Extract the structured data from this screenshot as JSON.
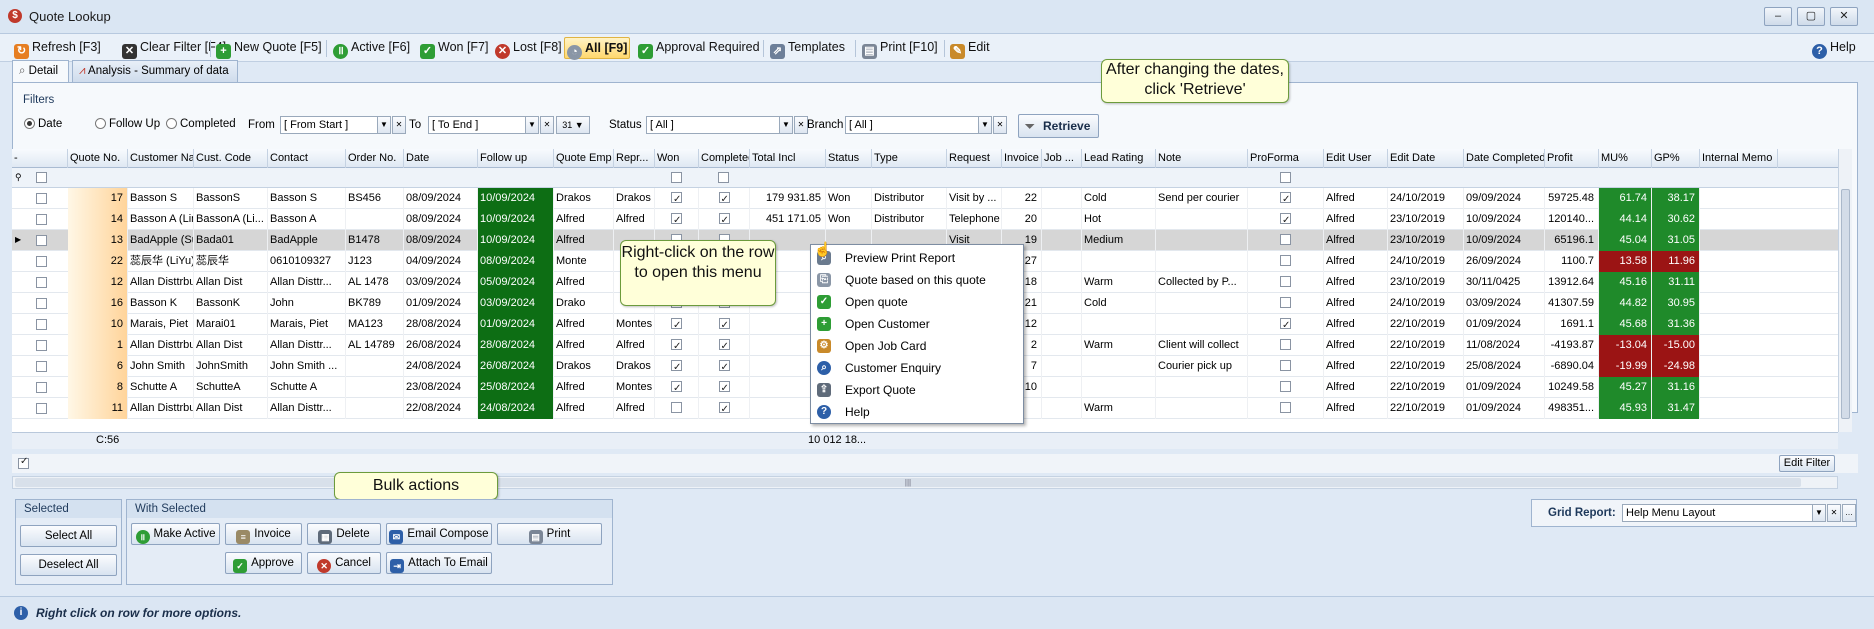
{
  "window": {
    "title": "Quote Lookup",
    "min": "–",
    "max": "▢",
    "close": "✕"
  },
  "toolbar": {
    "refresh": "Refresh [F3]",
    "clear_filter": "Clear Filter [F4]",
    "new_quote": "New Quote [F5]",
    "active": "Active [F6]",
    "won": "Won [F7]",
    "lost": "Lost [F8]",
    "all": "All [F9]",
    "approval": "Approval Required",
    "templates": "Templates",
    "print": "Print [F10]",
    "edit": "Edit",
    "help": "Help"
  },
  "tabs": {
    "detail": "Detail",
    "analysis": "Analysis - Summary of data"
  },
  "filters": {
    "title": "Filters",
    "date": "Date",
    "follow_up": "Follow Up",
    "completed": "Completed",
    "from_label": "From",
    "from_value": "[ From Start ]",
    "to_label": "To",
    "to_value": "[ To End ]",
    "calendar": "31",
    "status_label": "Status",
    "status_value": "[ All ]",
    "branch_label": "Branch",
    "branch_value": "[ All ]",
    "retrieve": "Retrieve"
  },
  "grid": {
    "columns": [
      "-",
      "Quote No.",
      "Customer Name",
      "Cust. Code",
      "Contact",
      "Order No.",
      "Date",
      "Follow up",
      "Quote Emp",
      "Repr...",
      "Won",
      "Completed",
      "Total Incl",
      "Status",
      "Type",
      "Request",
      "Invoice",
      "Job ...",
      "Lead Rating",
      "Note",
      "ProForma",
      "Edit User",
      "Edit Date",
      "Date Completed",
      "Profit",
      "MU%",
      "GP%",
      "Internal Memo"
    ],
    "rows": [
      {
        "q": "17",
        "name": "Basson S",
        "code": "BassonS",
        "contact": "Basson S",
        "order": "BS456",
        "date": "08/09/2024",
        "fu": "10/09/2024",
        "emp": "Drakos",
        "rep": "Drakos",
        "won": true,
        "comp": true,
        "total": "179 931.85",
        "status": "Won",
        "type": "Distributor",
        "req": "Visit by ...",
        "inv": "22",
        "job": "",
        "lead": "Cold",
        "note": "Send per courier",
        "pro": true,
        "user": "Alfred",
        "edate": "24/10/2019",
        "dcomp": "09/09/2024",
        "profit": "59725.48",
        "mu": "61.74",
        "gp": "38.17",
        "neg": false
      },
      {
        "q": "14",
        "name": "Basson A (Linked A...",
        "code": "BassonA (Li...",
        "contact": "Basson A",
        "order": "",
        "date": "08/09/2024",
        "fu": "10/09/2024",
        "emp": "Alfred",
        "rep": "Alfred",
        "won": true,
        "comp": true,
        "total": "451 171.05",
        "status": "Won",
        "type": "Distributor",
        "req": "Telephone",
        "inv": "20",
        "job": "",
        "lead": "Hot",
        "note": "",
        "pro": true,
        "user": "Alfred",
        "edate": "23/10/2019",
        "dcomp": "10/09/2024",
        "profit": "120140...",
        "mu": "44.14",
        "gp": "30.62",
        "neg": false
      },
      {
        "q": "13",
        "name": "BadApple (Suspend...",
        "code": "Bada01",
        "contact": "BadApple",
        "order": "B1478",
        "date": "08/09/2024",
        "fu": "10/09/2024",
        "emp": "Alfred",
        "rep": "",
        "won": false,
        "comp": false,
        "total": "",
        "status": "",
        "type": "",
        "req": "Visit",
        "inv": "19",
        "job": "",
        "lead": "Medium",
        "note": "",
        "pro": false,
        "user": "Alfred",
        "edate": "23/10/2019",
        "dcomp": "10/09/2024",
        "profit": "65196.1",
        "mu": "45.04",
        "gp": "31.05",
        "neg": false
      },
      {
        "q": "22",
        "name": "蕊辰华 (LiYu)",
        "code": "蕊辰华",
        "contact": "0610109327",
        "order": "J123",
        "date": "04/09/2024",
        "fu": "08/09/2024",
        "emp": "Monte",
        "rep": "",
        "won": false,
        "comp": false,
        "total": "",
        "status": "",
        "type": "",
        "req": "",
        "inv": "27",
        "job": "",
        "lead": "",
        "note": "",
        "pro": false,
        "user": "Alfred",
        "edate": "24/10/2019",
        "dcomp": "26/09/2024",
        "profit": "1100.7",
        "mu": "13.58",
        "gp": "11.96",
        "neg": true
      },
      {
        "q": "12",
        "name": "Allan Disttrbutors",
        "code": "Allan Dist",
        "contact": "Allan Disttr...",
        "order": "AL 1478",
        "date": "03/09/2024",
        "fu": "05/09/2024",
        "emp": "Alfred",
        "rep": "",
        "won": false,
        "comp": false,
        "total": "",
        "status": "",
        "type": "",
        "req": "phone",
        "inv": "18",
        "job": "",
        "lead": "Warm",
        "note": "Collected by P...",
        "pro": false,
        "user": "Alfred",
        "edate": "23/10/2019",
        "dcomp": "30/11/0425",
        "profit": "13912.64",
        "mu": "45.16",
        "gp": "31.11",
        "neg": false
      },
      {
        "q": "16",
        "name": "Basson K",
        "code": "BassonK",
        "contact": "John",
        "order": "BK789",
        "date": "01/09/2024",
        "fu": "03/09/2024",
        "emp": "Drako",
        "rep": "",
        "won": false,
        "comp": false,
        "total": "",
        "status": "",
        "type": "",
        "req": "by ...",
        "inv": "21",
        "job": "",
        "lead": "Cold",
        "note": "",
        "pro": false,
        "user": "Alfred",
        "edate": "24/10/2019",
        "dcomp": "03/09/2024",
        "profit": "41307.59",
        "mu": "44.82",
        "gp": "30.95",
        "neg": false
      },
      {
        "q": "10",
        "name": "Marais, Piet",
        "code": "Marai01",
        "contact": "Marais, Piet",
        "order": "MA123",
        "date": "28/08/2024",
        "fu": "01/09/2024",
        "emp": "Alfred",
        "rep": "Montes",
        "won": true,
        "comp": true,
        "total": "",
        "status": "",
        "type": "",
        "req": "",
        "inv": "12",
        "job": "",
        "lead": "",
        "note": "",
        "pro": true,
        "user": "Alfred",
        "edate": "22/10/2019",
        "dcomp": "01/09/2024",
        "profit": "1691.1",
        "mu": "45.68",
        "gp": "31.36",
        "neg": false
      },
      {
        "q": "1",
        "name": "Allan Disttrbutors",
        "code": "Allan Dist",
        "contact": "Allan Disttr...",
        "order": "AL 14789",
        "date": "26/08/2024",
        "fu": "28/08/2024",
        "emp": "Alfred",
        "rep": "Alfred",
        "won": true,
        "comp": true,
        "total": "",
        "status": "",
        "type": "",
        "req": "",
        "inv": "2",
        "job": "",
        "lead": "Warm",
        "note": "Client will collect",
        "pro": false,
        "user": "Alfred",
        "edate": "22/10/2019",
        "dcomp": "11/08/2024",
        "profit": "-4193.87",
        "mu": "-13.04",
        "gp": "-15.00",
        "neg": true
      },
      {
        "q": "6",
        "name": "John Smith",
        "code": "JohnSmith",
        "contact": "John Smith ...",
        "order": "",
        "date": "24/08/2024",
        "fu": "26/08/2024",
        "emp": "Drakos",
        "rep": "Drakos",
        "won": true,
        "comp": true,
        "total": "",
        "status": "",
        "type": "",
        "req": "",
        "inv": "7",
        "job": "",
        "lead": "",
        "note": "Courier pick up",
        "pro": false,
        "user": "Alfred",
        "edate": "22/10/2019",
        "dcomp": "25/08/2024",
        "profit": "-6890.04",
        "mu": "-19.99",
        "gp": "-24.98",
        "neg": true
      },
      {
        "q": "8",
        "name": "Schutte A",
        "code": "SchutteA",
        "contact": "Schutte A",
        "order": "",
        "date": "23/08/2024",
        "fu": "25/08/2024",
        "emp": "Alfred",
        "rep": "Montes",
        "won": true,
        "comp": true,
        "total": "",
        "status": "",
        "type": "",
        "req": "",
        "inv": "10",
        "job": "",
        "lead": "",
        "note": "",
        "pro": false,
        "user": "Alfred",
        "edate": "22/10/2019",
        "dcomp": "01/09/2024",
        "profit": "10249.58",
        "mu": "45.27",
        "gp": "31.16",
        "neg": false
      },
      {
        "q": "11",
        "name": "Allan Disttrbutors",
        "code": "Allan Dist",
        "contact": "Allan Disttr...",
        "order": "",
        "date": "22/08/2024",
        "fu": "24/08/2024",
        "emp": "Alfred",
        "rep": "Alfred",
        "won": false,
        "comp": true,
        "total": "",
        "status": "",
        "type": "",
        "req": "",
        "inv": "",
        "job": "",
        "lead": "Warm",
        "note": "",
        "pro": false,
        "user": "Alfred",
        "edate": "22/10/2019",
        "dcomp": "01/09/2024",
        "profit": "498351...",
        "mu": "45.93",
        "gp": "31.47",
        "neg": false
      }
    ],
    "footer_count": "C:56",
    "footer_total": "10 012 18...",
    "edit_filter": "Edit Filter",
    "splitter": "|||"
  },
  "context_menu": [
    "Preview Print Report",
    "Quote based on this quote",
    "Open quote",
    "Open Customer",
    "Open Job Card",
    "Customer Enquiry",
    "Export Quote",
    "Help"
  ],
  "callouts": {
    "retrieve": "After changing the dates, click 'Retrieve'",
    "right_click": "Right-click on the row to open this menu",
    "bulk": "Bulk actions"
  },
  "selected": {
    "title": "Selected",
    "select_all": "Select All",
    "deselect_all": "Deselect All"
  },
  "with_selected": {
    "title": "With Selected",
    "make_active": "Make Active",
    "invoice": "Invoice",
    "delete": "Delete",
    "email": "Email Compose",
    "print": "Print",
    "approve": "Approve",
    "cancel": "Cancel",
    "attach": "Attach To Email"
  },
  "grid_report": {
    "label": "Grid Report:",
    "value": "Help Menu Layout"
  },
  "status_bar": {
    "text": "Right click on row for more options."
  }
}
